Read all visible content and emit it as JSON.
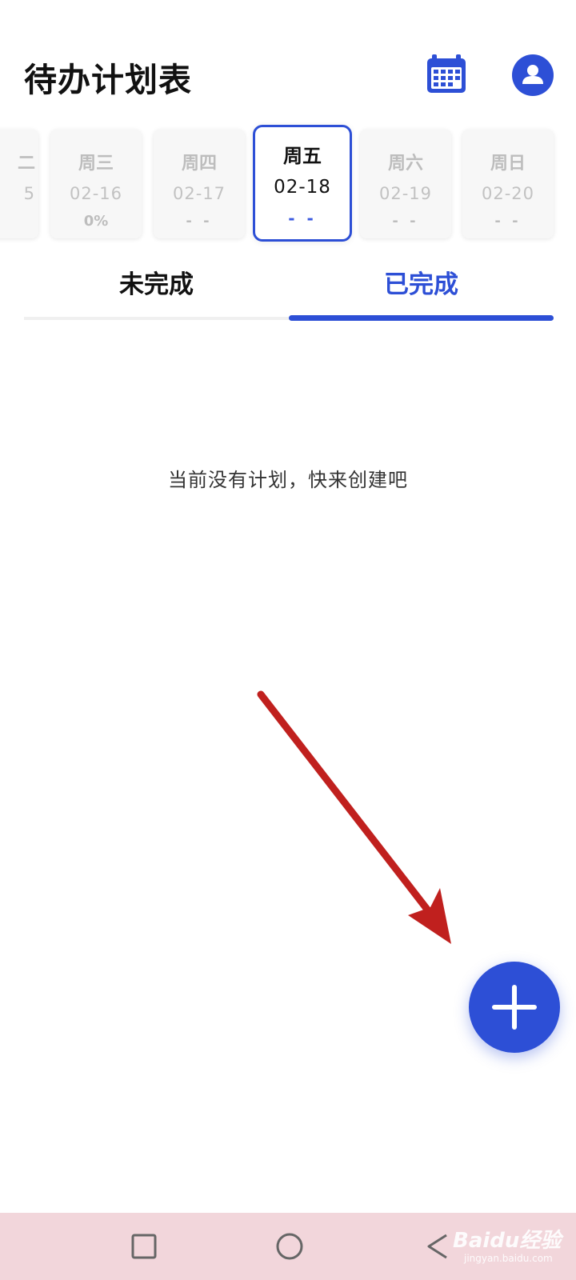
{
  "header": {
    "title": "待办计划表",
    "calendar_icon": "calendar-icon",
    "profile_icon": "user-avatar-icon"
  },
  "date_strip": {
    "days": [
      {
        "weekday": "二",
        "date": "5",
        "progress": ""
      },
      {
        "weekday": "周三",
        "date": "02-16",
        "progress": "0%"
      },
      {
        "weekday": "周四",
        "date": "02-17",
        "progress": "- -"
      },
      {
        "weekday": "周五",
        "date": "02-18",
        "progress": "- -"
      },
      {
        "weekday": "周六",
        "date": "02-19",
        "progress": "- -"
      },
      {
        "weekday": "周日",
        "date": "02-20",
        "progress": "- -"
      }
    ],
    "selected_index": 3
  },
  "tabs": {
    "items": [
      {
        "label": "未完成"
      },
      {
        "label": "已完成"
      }
    ],
    "active_index": 1
  },
  "main": {
    "empty_message": "当前没有计划，快来创建吧"
  },
  "fab": {
    "icon": "plus-icon"
  },
  "nav_bar": {
    "recent_icon": "square-icon",
    "home_icon": "circle-icon",
    "back_icon": "triangle-back-icon"
  },
  "watermark": {
    "brand": "Baidu经验",
    "site": "jingyan.baidu.com"
  },
  "colors": {
    "accent": "#2d4fd6",
    "annotation_arrow": "#c0201e",
    "nav_bar_bg": "#f2d6db"
  }
}
